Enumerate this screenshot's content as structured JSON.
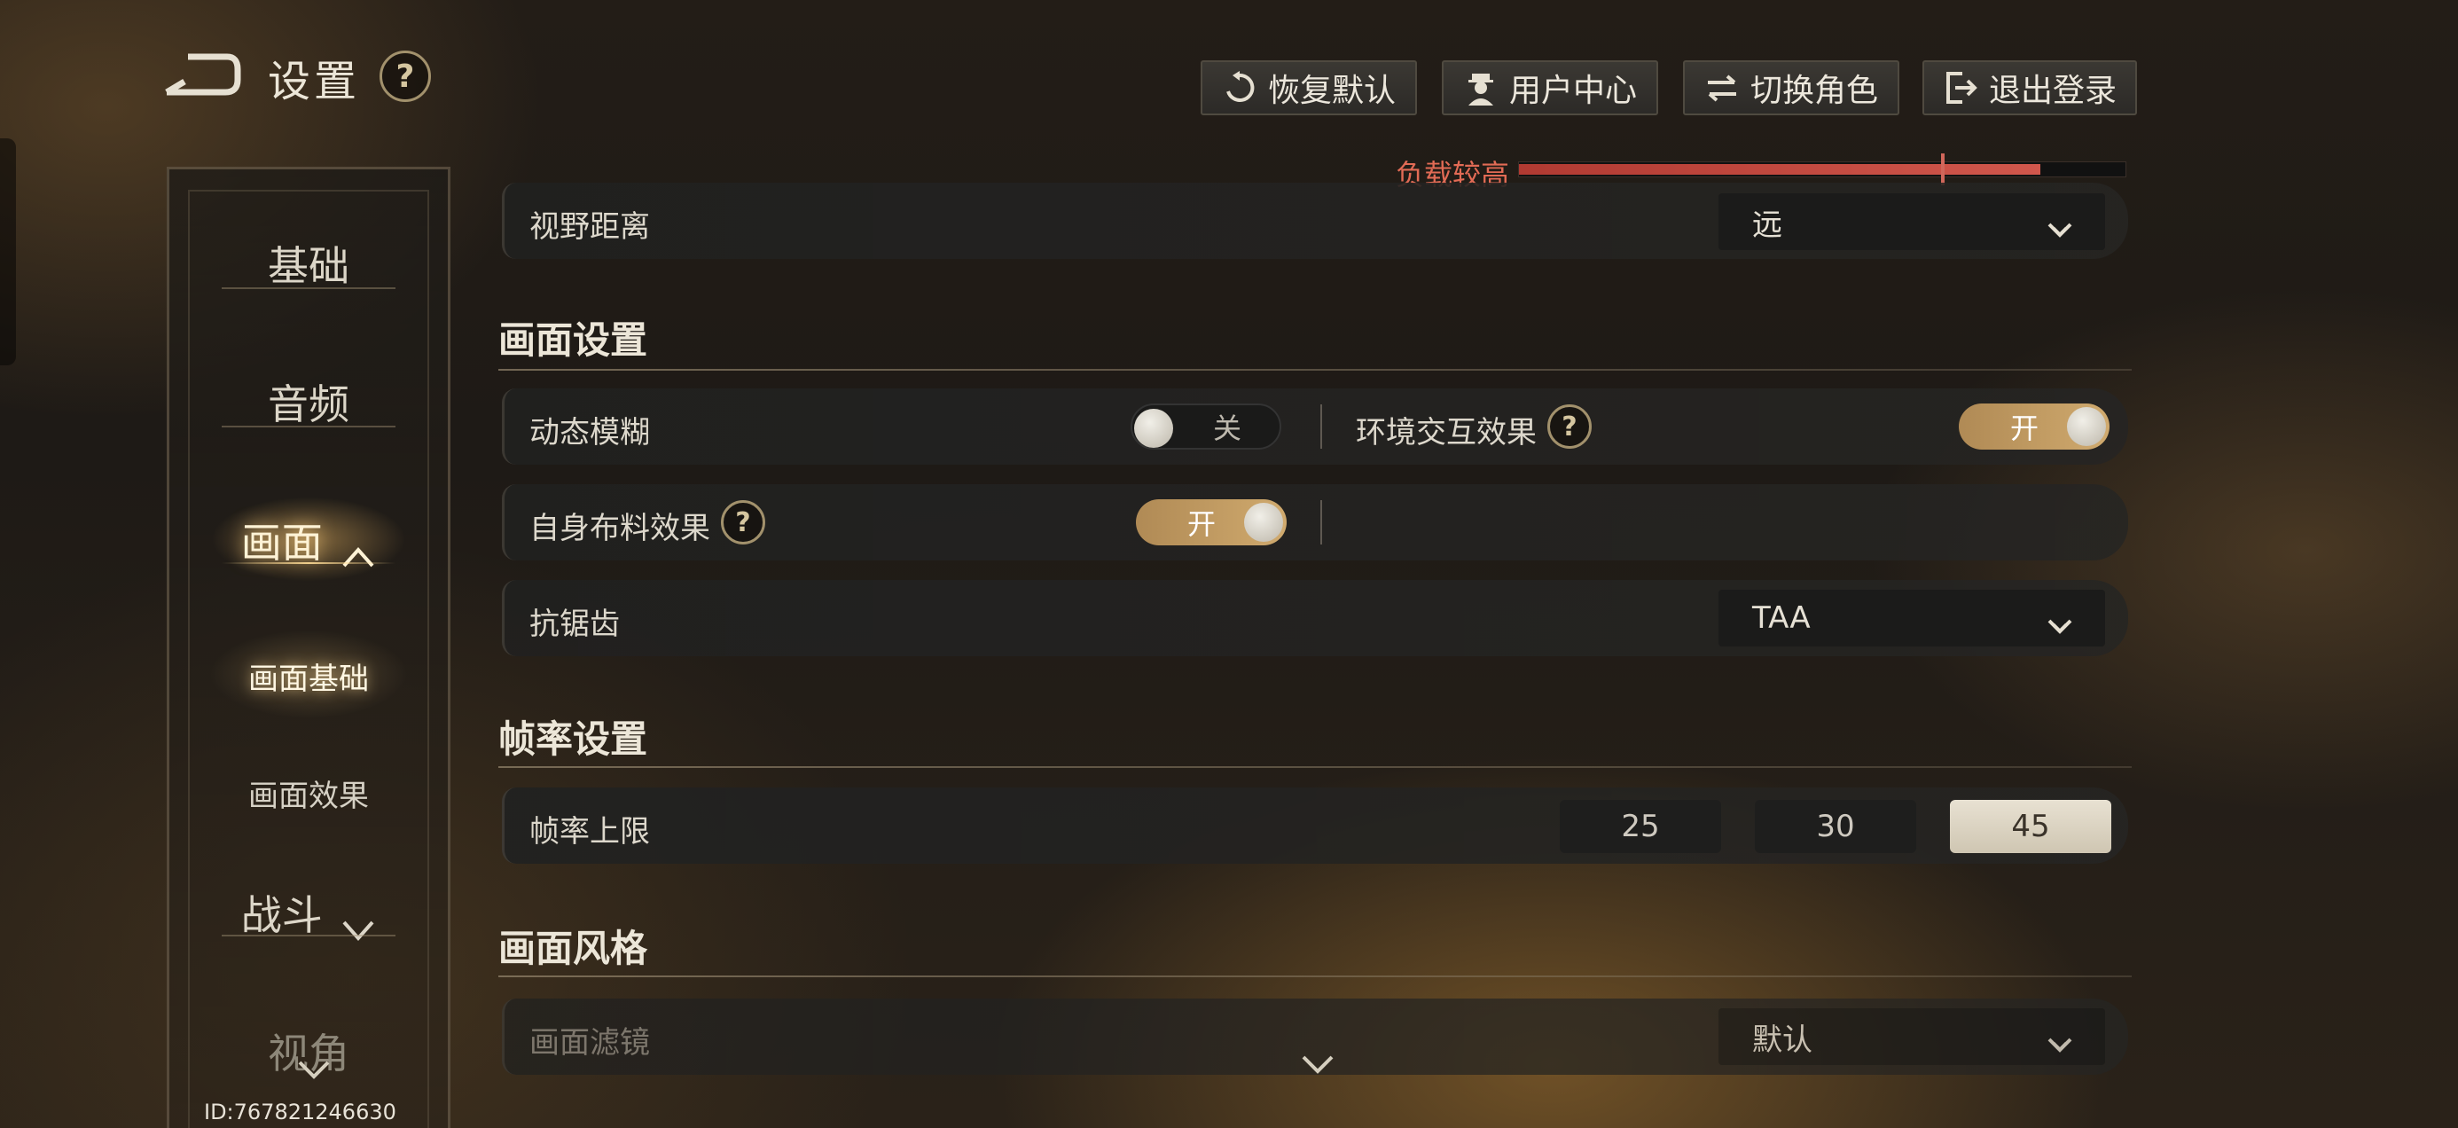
{
  "header": {
    "title": "设置",
    "help_icon": "question-icon",
    "buttons": [
      {
        "label": "恢复默认",
        "icon": "reset-icon"
      },
      {
        "label": "用户中心",
        "icon": "user-icon"
      },
      {
        "label": "切换角色",
        "icon": "swap-icon"
      },
      {
        "label": "退出登录",
        "icon": "logout-icon"
      }
    ]
  },
  "load": {
    "label": "负载较高",
    "level_fraction": 0.86,
    "color": "#d1574c"
  },
  "sidebar": {
    "items": [
      {
        "label": "基础"
      },
      {
        "label": "音频"
      },
      {
        "label": "画面",
        "expanded": true,
        "active": true
      },
      {
        "label": "战斗",
        "expanded": false
      },
      {
        "label": "视角"
      }
    ],
    "subitems": [
      {
        "label": "画面基础",
        "active": true
      },
      {
        "label": "画面效果"
      }
    ],
    "user_id": "ID:767821246630"
  },
  "rows": {
    "view_distance": {
      "label": "视野距离",
      "value": "远"
    },
    "motion_blur": {
      "label": "动态模糊",
      "state": "关"
    },
    "env_interaction": {
      "label": "环境交互效果",
      "state": "开"
    },
    "self_cloth": {
      "label": "自身布料效果",
      "state": "开"
    },
    "anti_alias": {
      "label": "抗锯齿",
      "value": "TAA"
    },
    "fps_cap": {
      "label": "帧率上限",
      "options": [
        "25",
        "30",
        "45"
      ],
      "selected": "45"
    },
    "filter": {
      "label": "画面滤镜",
      "value": "默认"
    }
  },
  "sections": {
    "graphics": "画面设置",
    "framerate": "帧率设置",
    "style": "画面风格"
  },
  "accent_color": "#c9a46a"
}
